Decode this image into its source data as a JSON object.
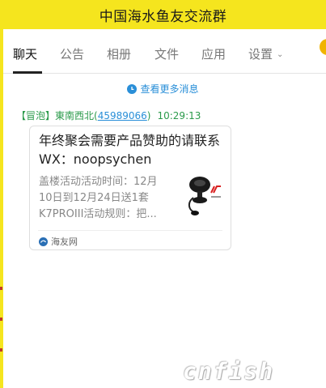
{
  "header": {
    "title": "中国海水鱼友交流群"
  },
  "tabs": [
    {
      "label": "聊天",
      "active": true
    },
    {
      "label": "公告"
    },
    {
      "label": "相册"
    },
    {
      "label": "文件"
    },
    {
      "label": "应用"
    },
    {
      "label": "设置"
    }
  ],
  "chat": {
    "more_messages": "查看更多消息",
    "message": {
      "badge": "【冒泡】",
      "sender": "東南西北",
      "uid": "45989066",
      "time": "10:29:13"
    },
    "card": {
      "title": "年终聚会需要产品赞助的请联系WX：noopsychen",
      "desc_lines": [
        "盖楼活动活动时间：12月",
        "10日到12月24日送1套",
        "K7PROIII活动规则：把..."
      ],
      "source": "海友网"
    }
  },
  "watermark": "cnfish",
  "colors": {
    "accent_yellow": "#f5e51e",
    "link_blue": "#2a8fd8",
    "meta_green": "#2a9a4a"
  },
  "icons": {
    "more": "clock-icon",
    "settings_dropdown": "chevron-down-icon",
    "source": "site-logo-icon"
  }
}
